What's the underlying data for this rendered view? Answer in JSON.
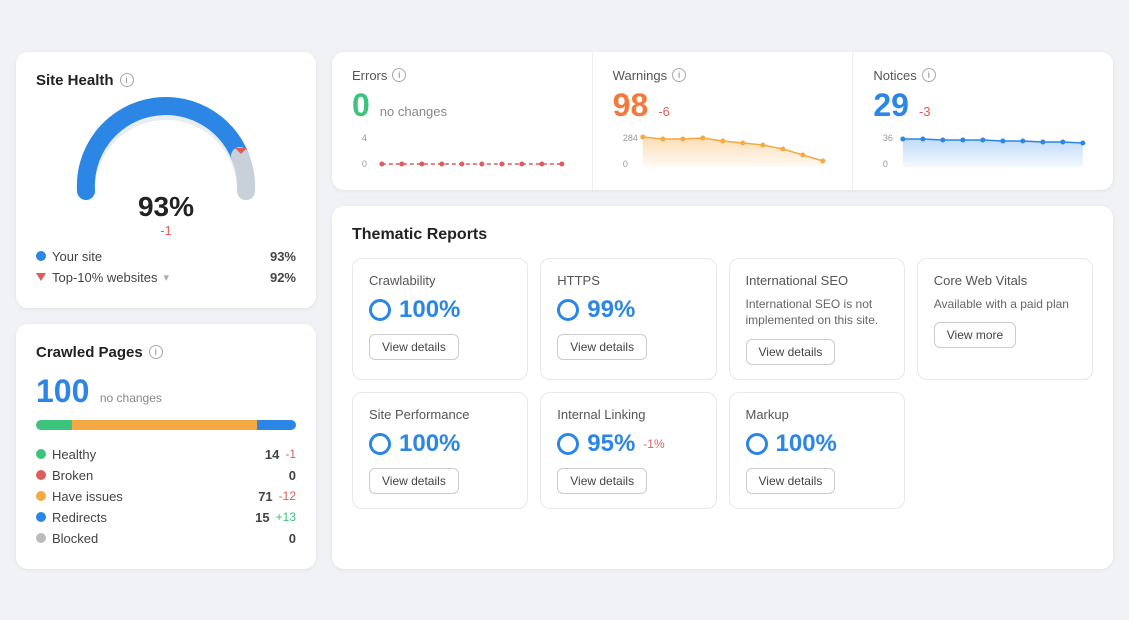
{
  "siteHealth": {
    "title": "Site Health",
    "percent": "93%",
    "delta": "-1",
    "yourSite": {
      "label": "Your site",
      "value": "93%",
      "color": "#2b86e6"
    },
    "topSites": {
      "label": "Top-10% websites",
      "value": "92%",
      "color": "#e05c5c"
    }
  },
  "crawledPages": {
    "title": "Crawled Pages",
    "count": "100",
    "subtitle": "no changes",
    "bars": [
      {
        "label": "Healthy",
        "color": "#3cc47c",
        "pct": 14
      },
      {
        "label": "Broken",
        "color": "#e05c5c",
        "pct": 0
      },
      {
        "label": "Have issues",
        "color": "#f4a942",
        "pct": 71
      },
      {
        "label": "Redirects",
        "color": "#2b86e6",
        "pct": 15
      },
      {
        "label": "Blocked",
        "color": "#bbb",
        "pct": 0
      }
    ],
    "stats": [
      {
        "label": "Healthy",
        "value": "14",
        "delta": "-1",
        "deltaType": "neg",
        "color": "#3cc47c"
      },
      {
        "label": "Broken",
        "value": "0",
        "delta": "",
        "deltaType": "",
        "color": "#e05c5c"
      },
      {
        "label": "Have issues",
        "value": "71",
        "delta": "-12",
        "deltaType": "neg",
        "color": "#f4a942"
      },
      {
        "label": "Redirects",
        "value": "15",
        "delta": "+13",
        "deltaType": "pos",
        "color": "#2b86e6"
      },
      {
        "label": "Blocked",
        "value": "0",
        "delta": "",
        "deltaType": "",
        "color": "#bbb"
      }
    ]
  },
  "metrics": {
    "errors": {
      "label": "Errors",
      "value": "0",
      "valueClass": "error",
      "delta": "no changes",
      "deltaClass": "",
      "chartMax": "4",
      "chartMin": "0"
    },
    "warnings": {
      "label": "Warnings",
      "value": "98",
      "valueClass": "warning",
      "delta": "-6",
      "deltaClass": "neg",
      "chartMax": "284",
      "chartMin": "0"
    },
    "notices": {
      "label": "Notices",
      "value": "29",
      "valueClass": "notice",
      "delta": "-3",
      "deltaClass": "neg",
      "chartMax": "36",
      "chartMin": "0"
    }
  },
  "thematicReports": {
    "title": "Thematic Reports",
    "topRow": [
      {
        "title": "Crawlability",
        "score": "100%",
        "delta": "",
        "hasScore": true,
        "desc": "",
        "buttonLabel": "View details",
        "buttonType": "details"
      },
      {
        "title": "HTTPS",
        "score": "99%",
        "delta": "",
        "hasScore": true,
        "desc": "",
        "buttonLabel": "View details",
        "buttonType": "details"
      },
      {
        "title": "International SEO",
        "score": "",
        "delta": "",
        "hasScore": false,
        "desc": "International SEO is not implemented on this site.",
        "buttonLabel": "View details",
        "buttonType": "details"
      },
      {
        "title": "Core Web Vitals",
        "score": "",
        "delta": "",
        "hasScore": false,
        "desc": "Available with a paid plan",
        "buttonLabel": "View more",
        "buttonType": "more"
      }
    ],
    "bottomRow": [
      {
        "title": "Site Performance",
        "score": "100%",
        "delta": "",
        "hasScore": true,
        "desc": "",
        "buttonLabel": "View details",
        "buttonType": "details"
      },
      {
        "title": "Internal Linking",
        "score": "95%",
        "delta": "-1%",
        "hasScore": true,
        "desc": "",
        "buttonLabel": "View details",
        "buttonType": "details"
      },
      {
        "title": "Markup",
        "score": "100%",
        "delta": "",
        "hasScore": true,
        "desc": "",
        "buttonLabel": "View details",
        "buttonType": "details"
      },
      {
        "title": "",
        "score": "",
        "delta": "",
        "hasScore": false,
        "desc": "",
        "buttonLabel": "",
        "buttonType": "empty"
      }
    ]
  }
}
